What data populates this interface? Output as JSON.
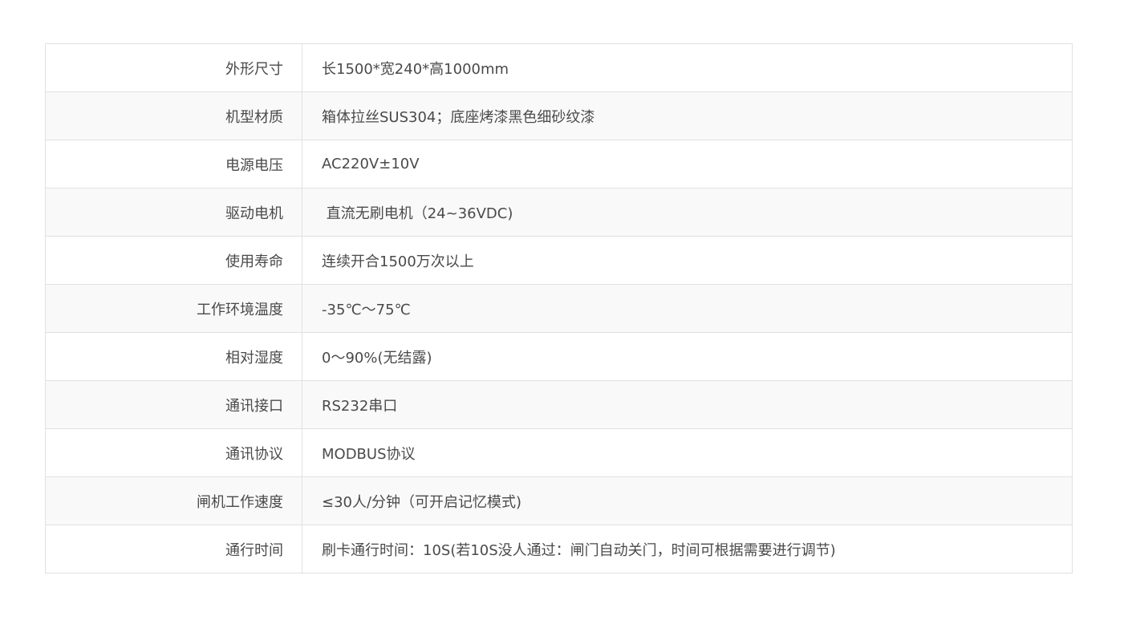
{
  "spec_table": {
    "rows": [
      {
        "label": "外形尺寸",
        "value": "长1500*宽240*高1000mm"
      },
      {
        "label": "机型材质",
        "value": "箱体拉丝SUS304；底座烤漆黑色细砂纹漆"
      },
      {
        "label": "电源电压",
        "value": "AC220V±10V"
      },
      {
        "label": "驱动电机",
        "value": " 直流无刷电机（24~36VDC)"
      },
      {
        "label": "使用寿命",
        "value": "连续开合1500万次以上"
      },
      {
        "label": "工作环境温度",
        "value": "-35℃～75℃"
      },
      {
        "label": "相对湿度",
        "value": "0～90%(无结露)"
      },
      {
        "label": "通讯接口",
        "value": "RS232串口"
      },
      {
        "label": "通讯协议",
        "value": "MODBUS协议"
      },
      {
        "label": "闸机工作速度",
        "value": "≤30人/分钟（可开启记忆模式)"
      },
      {
        "label": "通行时间",
        "value": "刷卡通行时间：10S(若10S没人通过：闸门自动关门，时间可根据需要进行调节)"
      }
    ]
  }
}
